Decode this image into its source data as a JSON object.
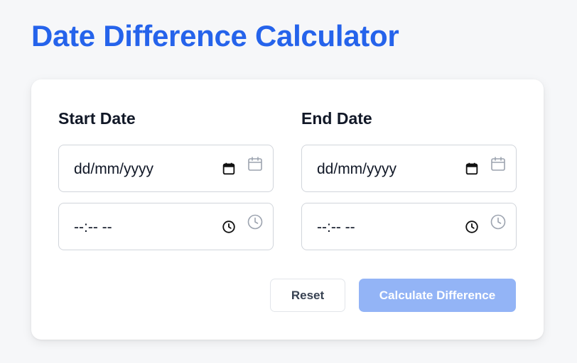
{
  "title": "Date Difference Calculator",
  "start": {
    "heading": "Start Date",
    "date_value": "dd/mm/yyyy",
    "time_value": "--:-- --"
  },
  "end": {
    "heading": "End Date",
    "date_value": "dd/mm/yyyy",
    "time_value": "--:-- --"
  },
  "buttons": {
    "reset_label": "Reset",
    "calculate_label": "Calculate Difference"
  },
  "icons": {
    "date_picker": "calendar-icon",
    "time_picker": "clock-icon"
  },
  "colors": {
    "accent": "#2563eb",
    "calculate_disabled": "#93b4f6",
    "page_background": "#f6f7f9",
    "card_background": "#ffffff",
    "decorative_icon": "#9ca3af"
  }
}
